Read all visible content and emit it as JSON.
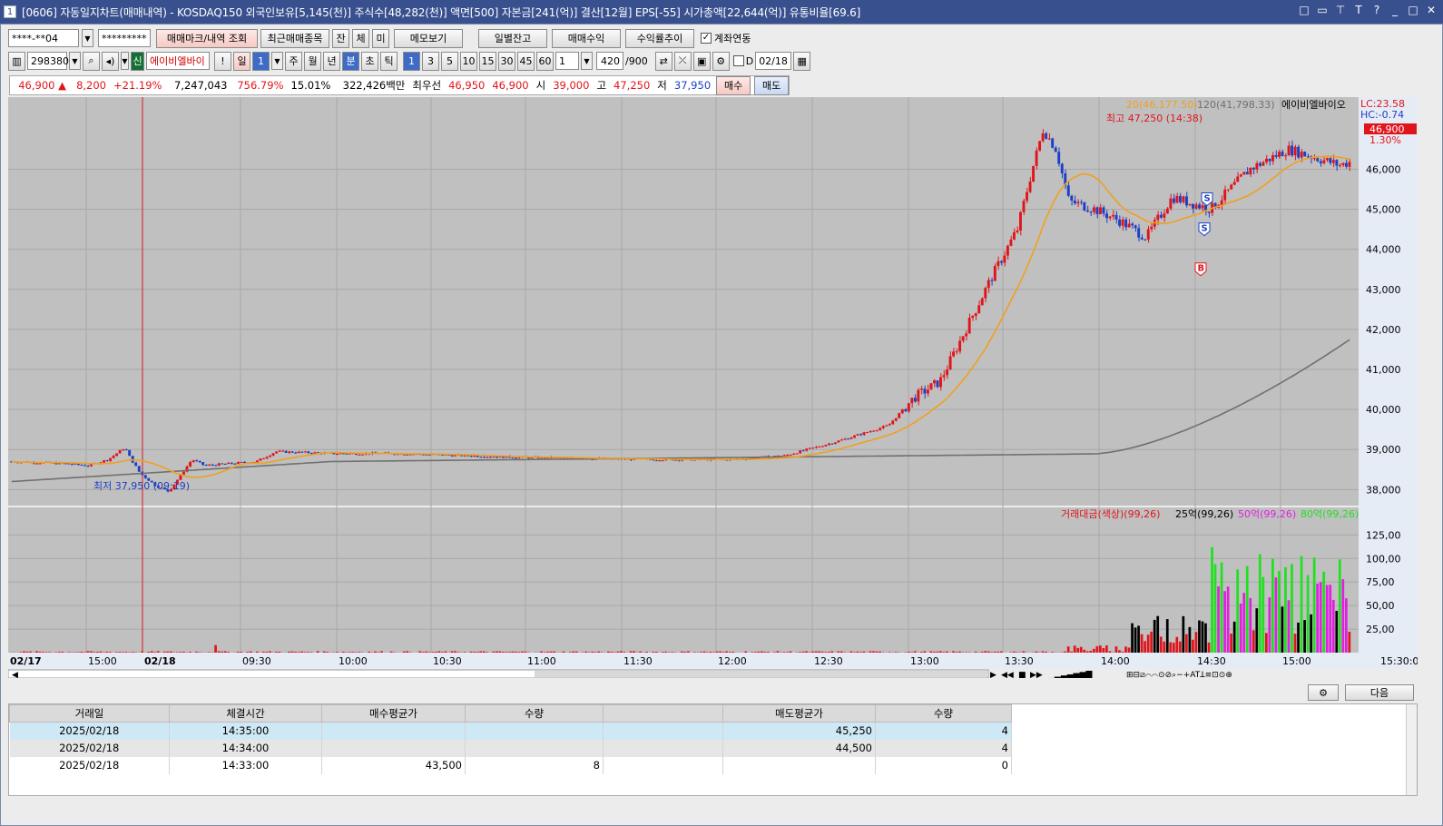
{
  "titlebar": {
    "number": "1",
    "text": "[0606] 자동일지차트(매매내역) - KOSDAQ150 외국인보유[5,145(천)] 주식수[48,282(천)] 액면[500] 자본금[241(억)] 결산[12월] EPS[-55] 시가총액[22,644(억)] 유통비율[69.6]",
    "controls": [
      "□",
      "▭",
      "⊤",
      "T",
      "?",
      "_",
      "□",
      "✕"
    ]
  },
  "toolbar1": {
    "account": "****-**04",
    "password": "*********",
    "btn_mark": "매매마크/내역 조회",
    "btn_recent": "최근매매종목",
    "btn_jan": "잔",
    "btn_che": "체",
    "btn_mi": "미",
    "btn_memo": "메모보기",
    "btn_daily": "일별잔고",
    "btn_profit": "매매수익",
    "btn_rate": "수익률추이",
    "link_label": "계좌연동"
  },
  "toolbar2": {
    "code": "298380",
    "badge": "신",
    "name": "에이비엘바이",
    "excl": "!",
    "day": "일",
    "day_val": "1",
    "periods": [
      "주",
      "월",
      "년",
      "분",
      "초",
      "틱"
    ],
    "minutes": [
      "1",
      "3",
      "5",
      "10",
      "15",
      "30",
      "45",
      "60"
    ],
    "count": "1",
    "bars": "420",
    "bars_total": "/900",
    "d_label": "D",
    "date": "02/18"
  },
  "quote": {
    "price": "46,900",
    "arrow": "▲",
    "change": "8,200",
    "pct": "+21.19%",
    "volume": "7,247,043",
    "vol_ratio": "756.79%",
    "turnover": "15.01%",
    "amount": "322,426백만",
    "best_label": "최우선",
    "best_ask": "46,950",
    "best_bid": "46,900",
    "open_label": "시",
    "open": "39,000",
    "high_label": "고",
    "high": "47,250",
    "low_label": "저",
    "low": "37,950",
    "buy": "매수",
    "sell": "매도"
  },
  "chart_data": {
    "type": "candlestick",
    "legend_ma20": "20(46,177.50)",
    "legend_ma120": "120(41,798.33)",
    "legend_name": "에이비엘바이오",
    "lc": "LC:23.58",
    "hc": "HC:-0.74",
    "last_price": "46,900",
    "last_pct": "1.30%",
    "high_note": "최고 47,250 (14:38)",
    "low_note": "최저 37,950 (09:19)",
    "yticks": [
      "46,000",
      "45,000",
      "44,000",
      "43,000",
      "42,000",
      "41,000",
      "40,000",
      "39,000",
      "38,000"
    ],
    "ytick_values": [
      46000,
      45000,
      44000,
      43000,
      42000,
      41000,
      40000,
      39000,
      38000
    ],
    "ylim": [
      37600,
      47800
    ],
    "vol_legend_main": "거래대금(색상)(99,26)",
    "vol_legend_25": "25억(99,26)",
    "vol_legend_50": "50억(99,26)",
    "vol_legend_80": "80억(99,26)",
    "vol_yticks": [
      "125,00",
      "100,00",
      "75,00",
      "50,00",
      "25,00"
    ],
    "vol_ytick_values": [
      125,
      100,
      75,
      50,
      25
    ],
    "vol_ylim": [
      0,
      135
    ],
    "xticks": [
      "02/17",
      "15:00",
      "02/18",
      "09:30",
      "10:00",
      "10:30",
      "11:00",
      "11:30",
      "12:00",
      "12:30",
      "13:00",
      "13:30",
      "14:00",
      "14:30",
      "15:00",
      "15:30:00"
    ],
    "trade_marks": [
      {
        "type": "B",
        "time": "14:33",
        "price": 43500
      },
      {
        "type": "S",
        "time": "14:34",
        "price": 44500
      },
      {
        "type": "S",
        "time": "14:35",
        "price": 45250
      }
    ],
    "colors": {
      "up": "#e0151b",
      "down": "#1d3fc6",
      "ma20": "#f0a020",
      "ma120": "#707070",
      "vol_small": "#e0151b",
      "vol_25": "#000000",
      "vol_50": "#e020e0",
      "vol_80": "#20e020"
    }
  },
  "bottom": {
    "next": "다음",
    "headers": [
      "거래일",
      "체결시간",
      "매수평균가",
      "수량",
      "",
      "매도평균가",
      "수량"
    ],
    "rows": [
      [
        "2025/02/18",
        "14:35:00",
        "",
        "",
        "",
        "45,250",
        "4"
      ],
      [
        "2025/02/18",
        "14:34:00",
        "",
        "",
        "",
        "44,500",
        "4"
      ],
      [
        "2025/02/18",
        "14:33:00",
        "43,500",
        "8",
        "",
        "",
        "0"
      ]
    ]
  }
}
